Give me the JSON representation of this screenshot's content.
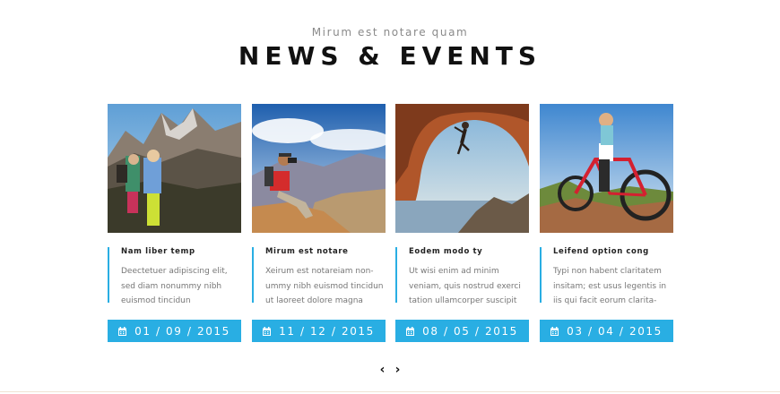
{
  "section": {
    "subtitle": "Mirum est notare quam",
    "title": "NEWS & EVENTS"
  },
  "posts": [
    {
      "title": "Nam liber temp",
      "excerpt": "Deectetuer adipiscing elit,\nsed diam nonummy nibh\neuismod tincidun",
      "date": "01 / 09 / 2015",
      "image": "hikers-on-mountain"
    },
    {
      "title": "Mirum est notare",
      "excerpt": "Xeirum est notareiam non-\nummy nibh euismod tincidun\nut laoreet dolore magna",
      "date": "11 / 12 / 2015",
      "image": "photographer-on-rocks"
    },
    {
      "title": "Eodem modo ty",
      "excerpt": "Ut wisi enim ad minim\nveniam, quis nostrud exerci\ntation ullamcorper suscipit",
      "date": "08 / 05 / 2015",
      "image": "rock-climber-arch"
    },
    {
      "title": "Leifend option cong",
      "excerpt": "Typi non habent claritatem\ninsitam; est usus legentis in\niis qui facit eorum clarita-",
      "date": "03 / 04 / 2015",
      "image": "cyclist-red-bike"
    }
  ],
  "colors": {
    "accent": "#29aee3",
    "title": "#111111",
    "excerpt": "#777777"
  },
  "nav": {
    "prev_icon": "chevron-left-icon",
    "next_icon": "chevron-right-icon"
  }
}
